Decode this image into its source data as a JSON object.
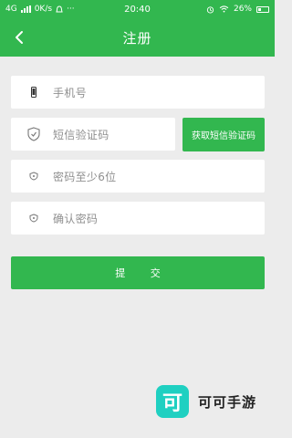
{
  "status": {
    "network": "4G",
    "speed": "0K/s",
    "time": "20:40",
    "battery": "26%"
  },
  "header": {
    "title": "注册"
  },
  "form": {
    "phone_placeholder": "手机号",
    "code_placeholder": "短信验证码",
    "get_code_label": "获取短信验证码",
    "password_placeholder": "密码至少6位",
    "confirm_placeholder": "确认密码",
    "submit_label": "提 交"
  },
  "watermark": {
    "logo_char": "可",
    "brand": "可可手游"
  },
  "colors": {
    "primary": "#32b74f",
    "background": "#ececec",
    "watermark_logo": "#1fd0c1"
  }
}
